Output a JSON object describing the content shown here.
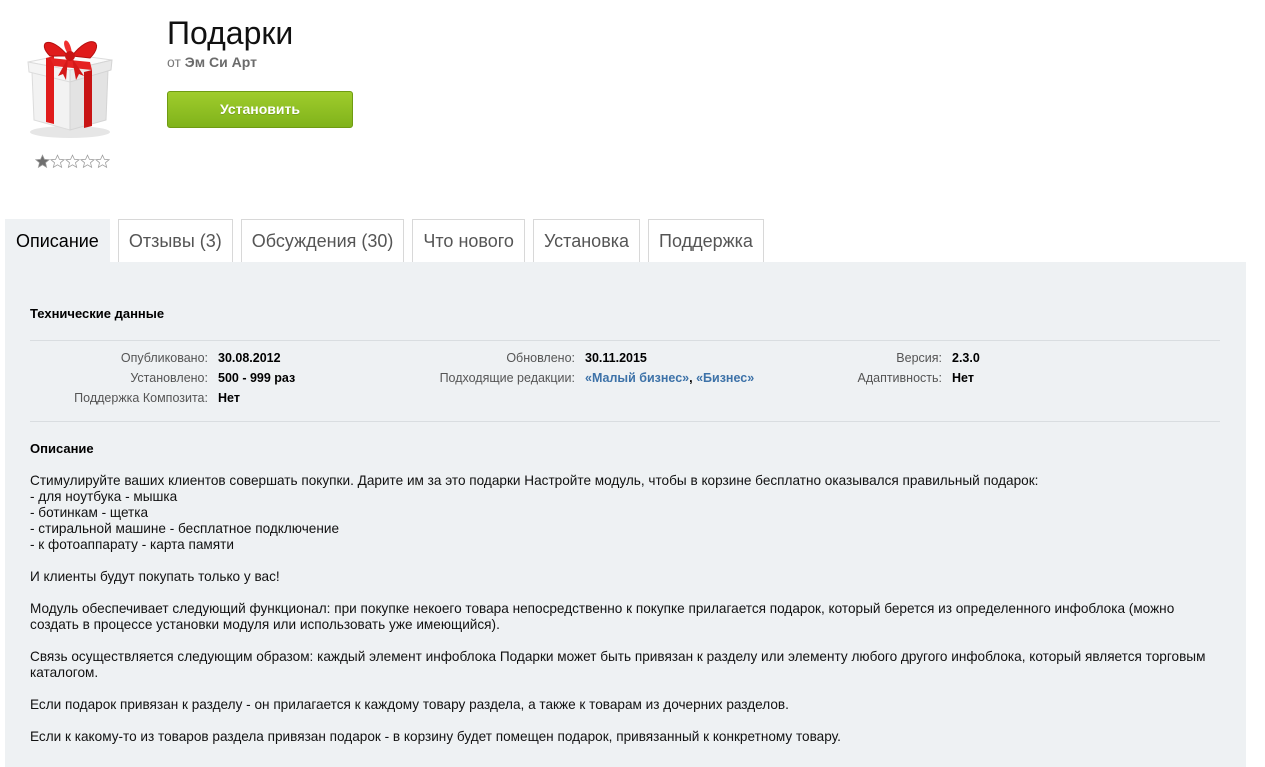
{
  "app": {
    "title": "Подарки",
    "vendor_prefix": "от",
    "vendor_name": "Эм Си Арт",
    "install_label": "Установить",
    "rating": 1,
    "rating_max": 5,
    "icon": "gift-box-icon"
  },
  "tabs": [
    {
      "label": "Описание",
      "active": true
    },
    {
      "label": "Отзывы (3)"
    },
    {
      "label": "Обсуждения (30)"
    },
    {
      "label": "Что нового"
    },
    {
      "label": "Установка"
    },
    {
      "label": "Поддержка"
    }
  ],
  "tech": {
    "heading": "Технические данные",
    "published_label": "Опубликовано:",
    "published_value": "30.08.2012",
    "installed_label": "Установлено:",
    "installed_value": "500 - 999 раз",
    "composite_label": "Поддержка Композита:",
    "composite_value": "Нет",
    "updated_label": "Обновлено:",
    "updated_value": "30.11.2015",
    "editions_label": "Подходящие редакции:",
    "edition1": "«Малый бизнес»",
    "edition_sep": ",",
    "edition2": "«Бизнес»",
    "version_label": "Версия:",
    "version_value": "2.3.0",
    "adaptive_label": "Адаптивность:",
    "adaptive_value": "Нет"
  },
  "description": {
    "heading": "Описание",
    "p1_l1": "Стимулируйте ваших клиентов совершать покупки. Дарите им за это подарки Настройте модуль, чтобы в корзине бесплатно оказывался правильный подарок:",
    "p1_l2": "- для ноутбука - мышка",
    "p1_l3": "- ботинкам - щетка",
    "p1_l4": "- стиральной машине - бесплатное подключение",
    "p1_l5": "- к фотоаппарату - карта памяти",
    "p2": "И клиенты будут покупать только у вас!",
    "p3": "Модуль обеспечивает следующий функционал: при покупке некоего товара непосредственно к покупке прилагается подарок, который берется из определенного инфоблока (можно создать в процессе установки модуля или использовать уже имеющийся).",
    "p4": "Связь осуществляется следующим образом: каждый элемент инфоблока Подарки может быть привязан к разделу или элементу любого другого инфоблока, который является торговым каталогом.",
    "p5": "Если подарок привязан к разделу - он прилагается к каждому товару раздела, а также к товарам из дочерних разделов.",
    "p6": "Если к какому-то из товаров раздела привязан подарок - в корзину будет помещен подарок, привязанный к конкретному товару."
  },
  "colors": {
    "accent_green": "#8cc024",
    "link_blue": "#3d72a8",
    "panel_bg": "#eef1f3",
    "ribbon_red": "#e01b1b"
  }
}
